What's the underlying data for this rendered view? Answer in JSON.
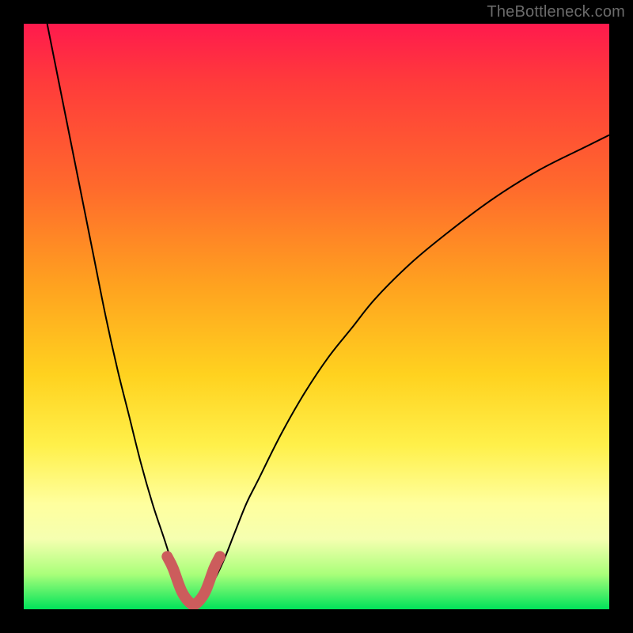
{
  "watermark": "TheBottleneck.com",
  "chart_data": {
    "type": "line",
    "title": "",
    "xlabel": "",
    "ylabel": "",
    "xlim": [
      0,
      100
    ],
    "ylim": [
      0,
      100
    ],
    "grid": false,
    "legend": false,
    "series": [
      {
        "name": "bottleneck-curve-left",
        "x": [
          4,
          6,
          8,
          10,
          12,
          14,
          16,
          18,
          20,
          22,
          24,
          26,
          28,
          29
        ],
        "values": [
          100,
          90,
          80,
          70,
          60,
          50,
          41,
          33,
          25,
          18,
          12,
          6,
          2,
          0
        ]
      },
      {
        "name": "bottleneck-curve-right",
        "x": [
          29,
          30,
          32,
          34,
          36,
          38,
          40,
          44,
          48,
          52,
          56,
          60,
          66,
          72,
          80,
          88,
          96,
          100
        ],
        "values": [
          0,
          1,
          4,
          8,
          13,
          18,
          22,
          30,
          37,
          43,
          48,
          53,
          59,
          64,
          70,
          75,
          79,
          81
        ]
      },
      {
        "name": "highlight-region",
        "x": [
          24.5,
          25.5,
          27,
          28.5,
          29.5,
          31,
          32.5,
          33.5
        ],
        "values": [
          9,
          7,
          3,
          1,
          1,
          3,
          7,
          9
        ]
      }
    ],
    "colors": {
      "gradient_top": "#ff1a4d",
      "gradient_mid": "#fff04a",
      "gradient_bottom": "#00e35a",
      "curve": "#000000",
      "highlight": "#cc5c5c",
      "frame": "#000000"
    }
  }
}
